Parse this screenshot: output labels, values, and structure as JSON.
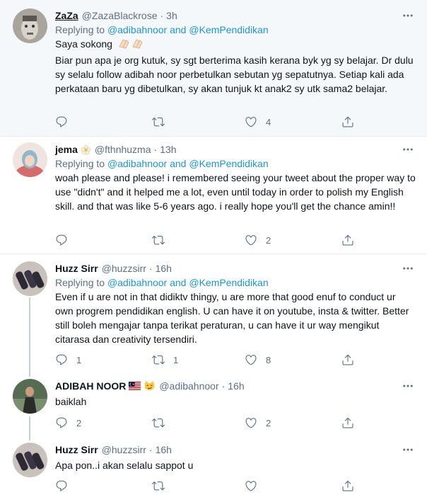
{
  "tweets": [
    {
      "name": "ZaZa",
      "handle": "@ZazaBlackrose",
      "dot": "·",
      "time": "3h",
      "replying_prefix": "Replying to",
      "replying_to_1": "@adibahnoor",
      "replying_and": "and",
      "replying_to_2": "@KemPendidikan",
      "line1": "Saya sokong",
      "line1_emoji": "clapping-hands-emoji",
      "body": "Biar pun apa je org kutuk, sy sgt berterima kasih kerana byk yg sy belajar. Dr dulu sy selalu follow adibah noor perbetulkan sebutan yg sepatutnya. Setiap kali ada perkataan baru yg dibetulkan, sy akan tunjuk kt anak2 sy utk sama2 belajar.",
      "reply_count": "",
      "retweet_count": "",
      "like_count": "4"
    },
    {
      "name": "jema",
      "name_emoji": "flower-emoji",
      "handle": "@fthnhuzma",
      "dot": "·",
      "time": "13h",
      "replying_prefix": "Replying to",
      "replying_to_1": "@adibahnoor",
      "replying_and": "and",
      "replying_to_2": "@KemPendidikan",
      "body": "woah please and please! i remembered seeing your tweet about the proper way to use \"didn't\" and it helped me a lot, even until today in order to polish my English skill. and that was like 5-6 years ago. i really hope you'll get the chance amin!!",
      "reply_count": "",
      "retweet_count": "",
      "like_count": "2"
    },
    {
      "name": "Huzz Sirr",
      "handle": "@huzzsirr",
      "dot": "·",
      "time": "16h",
      "replying_prefix": "Replying to",
      "replying_to_1": "@adibahnoor",
      "replying_and": "and",
      "replying_to_2": "@KemPendidikan",
      "body": "Even if u are not in that didiktv thingy, u are more that good enuf to conduct ur own progrem pendidikan english. U can have it on youtube, insta & twitter. Better still boleh mengajar tanpa terikat peraturan, u can have it ur way mengikut citarasa dan creativity tersendiri.",
      "reply_count": "1",
      "retweet_count": "1",
      "like_count": "8"
    },
    {
      "name": "ADIBAH NOOR",
      "name_emoji": "malaysia-flag-emoji, smirking-cat-emoji",
      "handle": "@adibahnoor",
      "dot": "·",
      "time": "16h",
      "body": "baiklah",
      "reply_count": "2",
      "retweet_count": "",
      "like_count": "2"
    },
    {
      "name": "Huzz Sirr",
      "handle": "@huzzsirr",
      "dot": "·",
      "time": "16h",
      "body": "Apa pon..i akan selalu sappot u",
      "reply_count": "",
      "retweet_count": "",
      "like_count": ""
    }
  ],
  "colors": {
    "accent": "#1b95e0",
    "muted": "#5b7083",
    "text": "#0f1419",
    "divider": "#e6ecf0",
    "thread_line": "#c4cfd6",
    "shaded_bg": "#f5f8fa"
  },
  "icons": [
    "more-icon",
    "reply-icon",
    "retweet-icon",
    "like-icon",
    "share-icon"
  ]
}
